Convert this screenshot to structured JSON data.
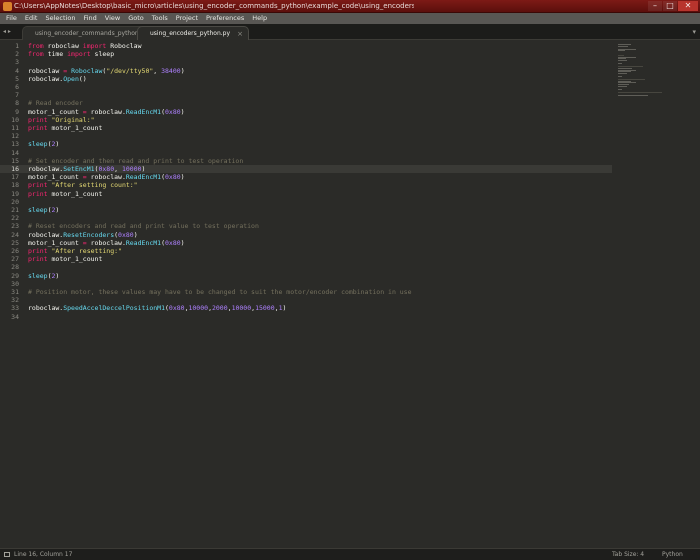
{
  "window": {
    "title": "C:\\Users\\AppNotes\\Desktop\\basic_micro\\articles\\using_encoder_commands_python\\example_code\\using_encoders_python.py • - Sublime Text (UNREGISTERED)",
    "minimize": "–",
    "maximize": "□",
    "close": "✕"
  },
  "menu": [
    "File",
    "Edit",
    "Selection",
    "Find",
    "View",
    "Goto",
    "Tools",
    "Project",
    "Preferences",
    "Help"
  ],
  "tabs": [
    {
      "label": "using_encoder_commands_python.html",
      "close": "×"
    },
    {
      "label": "using_encoders_python.py",
      "close": "×"
    }
  ],
  "tabbar": {
    "nav": "◂ ▸",
    "dropdown": "▾"
  },
  "editor": {
    "current_line": 16,
    "line_numbers": [
      "1",
      "2",
      "3",
      "4",
      "5",
      "6",
      "7",
      "8",
      "9",
      "10",
      "11",
      "12",
      "13",
      "14",
      "15",
      "16",
      "17",
      "18",
      "19",
      "20",
      "21",
      "22",
      "23",
      "24",
      "25",
      "26",
      "27",
      "28",
      "29",
      "30",
      "31",
      "32",
      "33",
      "34"
    ]
  },
  "code": [
    [
      {
        "t": "from",
        "c": "kw"
      },
      {
        "t": " roboclaw "
      },
      {
        "t": "import",
        "c": "kw"
      },
      {
        "t": " Roboclaw"
      }
    ],
    [
      {
        "t": "from",
        "c": "kw"
      },
      {
        "t": " time "
      },
      {
        "t": "import",
        "c": "kw"
      },
      {
        "t": " sleep"
      }
    ],
    [],
    [
      {
        "t": "roboclaw "
      },
      {
        "t": "=",
        "c": "kw"
      },
      {
        "t": " "
      },
      {
        "t": "Roboclaw",
        "c": "fn"
      },
      {
        "t": "("
      },
      {
        "t": "\"/dev/tty50\"",
        "c": "str"
      },
      {
        "t": ", "
      },
      {
        "t": "38400",
        "c": "num"
      },
      {
        "t": ")"
      }
    ],
    [
      {
        "t": "roboclaw."
      },
      {
        "t": "Open",
        "c": "fn"
      },
      {
        "t": "()"
      }
    ],
    [],
    [],
    [
      {
        "t": "# Read encoder",
        "c": "cm"
      }
    ],
    [
      {
        "t": "motor_1_count "
      },
      {
        "t": "=",
        "c": "kw"
      },
      {
        "t": " roboclaw."
      },
      {
        "t": "ReadEncM1",
        "c": "fn"
      },
      {
        "t": "("
      },
      {
        "t": "0x80",
        "c": "num"
      },
      {
        "t": ")"
      }
    ],
    [
      {
        "t": "print",
        "c": "kw"
      },
      {
        "t": " "
      },
      {
        "t": "\"Original:\"",
        "c": "str"
      }
    ],
    [
      {
        "t": "print",
        "c": "kw"
      },
      {
        "t": " motor_1_count"
      }
    ],
    [],
    [
      {
        "t": "sleep",
        "c": "fn"
      },
      {
        "t": "("
      },
      {
        "t": "2",
        "c": "num"
      },
      {
        "t": ")"
      }
    ],
    [],
    [
      {
        "t": "# Set encoder and then read and print to test operation",
        "c": "cm"
      }
    ],
    [
      {
        "t": "roboclaw."
      },
      {
        "t": "SetEncM1",
        "c": "fn"
      },
      {
        "t": "("
      },
      {
        "t": "0x80",
        "c": "num"
      },
      {
        "t": ", "
      },
      {
        "t": "10000",
        "c": "num"
      },
      {
        "t": ")"
      }
    ],
    [
      {
        "t": "motor_1_count "
      },
      {
        "t": "=",
        "c": "kw"
      },
      {
        "t": " roboclaw."
      },
      {
        "t": "ReadEncM1",
        "c": "fn"
      },
      {
        "t": "("
      },
      {
        "t": "0x80",
        "c": "num"
      },
      {
        "t": ")"
      }
    ],
    [
      {
        "t": "print",
        "c": "kw"
      },
      {
        "t": " "
      },
      {
        "t": "\"After setting count:\"",
        "c": "str"
      }
    ],
    [
      {
        "t": "print",
        "c": "kw"
      },
      {
        "t": " motor_1_count"
      }
    ],
    [],
    [
      {
        "t": "sleep",
        "c": "fn"
      },
      {
        "t": "("
      },
      {
        "t": "2",
        "c": "num"
      },
      {
        "t": ")"
      }
    ],
    [],
    [
      {
        "t": "# Reset encoders and read and print value to test operation",
        "c": "cm"
      }
    ],
    [
      {
        "t": "roboclaw."
      },
      {
        "t": "ResetEncoders",
        "c": "fn"
      },
      {
        "t": "("
      },
      {
        "t": "0x80",
        "c": "num"
      },
      {
        "t": ")"
      }
    ],
    [
      {
        "t": "motor_1_count "
      },
      {
        "t": "=",
        "c": "kw"
      },
      {
        "t": " roboclaw."
      },
      {
        "t": "ReadEncM1",
        "c": "fn"
      },
      {
        "t": "("
      },
      {
        "t": "0x80",
        "c": "num"
      },
      {
        "t": ")"
      }
    ],
    [
      {
        "t": "print",
        "c": "kw"
      },
      {
        "t": " "
      },
      {
        "t": "\"After resetting:\"",
        "c": "str"
      }
    ],
    [
      {
        "t": "print",
        "c": "kw"
      },
      {
        "t": " motor_1_count"
      }
    ],
    [],
    [
      {
        "t": "sleep",
        "c": "fn"
      },
      {
        "t": "("
      },
      {
        "t": "2",
        "c": "num"
      },
      {
        "t": ")"
      }
    ],
    [],
    [
      {
        "t": "# Position motor, these values may have to be changed to suit the motor/encoder combination in use",
        "c": "cm"
      }
    ],
    [],
    [
      {
        "t": "roboclaw."
      },
      {
        "t": "SpeedAccelDeccelPositionM1",
        "c": "fn"
      },
      {
        "t": "("
      },
      {
        "t": "0x80",
        "c": "num"
      },
      {
        "t": ","
      },
      {
        "t": "10000",
        "c": "num"
      },
      {
        "t": ","
      },
      {
        "t": "2000",
        "c": "num"
      },
      {
        "t": ","
      },
      {
        "t": "10000",
        "c": "num"
      },
      {
        "t": ","
      },
      {
        "t": "15000",
        "c": "num"
      },
      {
        "t": ","
      },
      {
        "t": "1",
        "c": "num"
      },
      {
        "t": ")"
      }
    ],
    []
  ],
  "status": {
    "position": "Line 16, Column 17",
    "tab_size": "Tab Size: 4",
    "syntax": "Python"
  },
  "colors": {
    "keyword": "#f92672",
    "function": "#66d9ef",
    "number": "#ae81ff",
    "string": "#e6db74",
    "comment": "#75715e",
    "background": "#2b2b28",
    "titlebar": "#7d1a16"
  }
}
